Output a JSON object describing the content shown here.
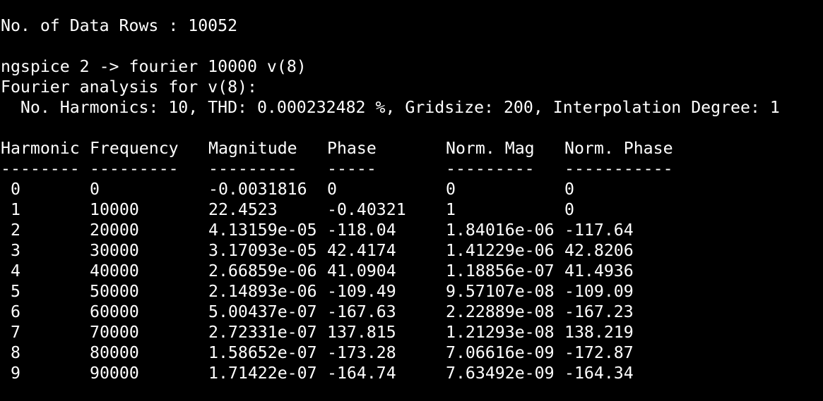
{
  "terminal": {
    "data_rows_line": "No. of Data Rows : 10052",
    "prompt_line": "ngspice 2 -> fourier 10000 v(8)",
    "analysis_title": "Fourier analysis for v(8):",
    "analysis_params": "  No. Harmonics: 10, THD: 0.000232482 %, Gridsize: 200, Interpolation Degree: 1"
  },
  "table": {
    "headers": [
      "Harmonic",
      "Frequency",
      "Magnitude",
      "Phase",
      "Norm. Mag",
      "Norm. Phase"
    ],
    "separators": [
      "--------",
      "---------",
      "---------",
      "-----",
      "---------",
      "-----------"
    ],
    "rows": [
      [
        " 0",
        "0",
        "-0.0031816",
        "0",
        "0",
        "0"
      ],
      [
        " 1",
        "10000",
        "22.4523",
        "-0.40321",
        "1",
        "0"
      ],
      [
        " 2",
        "20000",
        "4.13159e-05",
        "-118.04",
        "1.84016e-06",
        "-117.64"
      ],
      [
        " 3",
        "30000",
        "3.17093e-05",
        "42.4174",
        "1.41229e-06",
        "42.8206"
      ],
      [
        " 4",
        "40000",
        "2.66859e-06",
        "41.0904",
        "1.18856e-07",
        "41.4936"
      ],
      [
        " 5",
        "50000",
        "2.14893e-06",
        "-109.49",
        "9.57107e-08",
        "-109.09"
      ],
      [
        " 6",
        "60000",
        "5.00437e-07",
        "-167.63",
        "2.22889e-08",
        "-167.23"
      ],
      [
        " 7",
        "70000",
        "2.72331e-07",
        "137.815",
        "1.21293e-08",
        "138.219"
      ],
      [
        " 8",
        "80000",
        "1.58652e-07",
        "-173.28",
        "7.06616e-09",
        "-172.87"
      ],
      [
        " 9",
        "90000",
        "1.71422e-07",
        "-164.74",
        "7.63492e-09",
        "-164.34"
      ]
    ]
  }
}
